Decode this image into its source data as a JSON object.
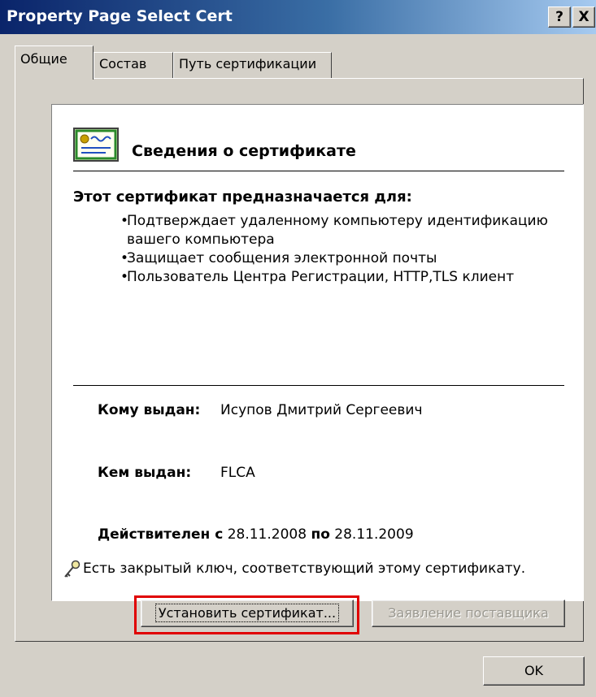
{
  "window": {
    "title": "Property Page Select Cert",
    "help_button": "?",
    "close_button": "X"
  },
  "tabs": [
    {
      "label": "Общие",
      "active": true
    },
    {
      "label": "Состав",
      "active": false
    },
    {
      "label": "Путь сертификации",
      "active": false
    }
  ],
  "certificate": {
    "icon": "certificate-icon",
    "title": "Сведения о сертификате",
    "purpose_heading": "Этот сертификат предназначается для:",
    "purposes": [
      "Подтверждает удаленному компьютеру идентификацию вашего компьютера",
      "Защищает сообщения электронной почты",
      "Пользователь Центра Регистрации, HTTP,TLS клиент"
    ],
    "issued_to_label": "Кому выдан:",
    "issued_to_value": "Исупов Дмитрий Сергеевич",
    "issued_by_label": "Кем выдан:",
    "issued_by_value": "FLCA",
    "valid_from_label": "Действителен с",
    "valid_from_value": "28.11.2008",
    "valid_to_label": "по",
    "valid_to_value": "28.11.2009",
    "private_key_icon": "key-icon",
    "private_key_text": "Есть закрытый ключ, соответствующий этому сертификату."
  },
  "buttons": {
    "install_certificate": "Установить сертификат...",
    "issuer_statement": "Заявление поставщика",
    "ok": "OK"
  },
  "colors": {
    "title_bar_start": "#0a246a",
    "title_bar_end": "#a6caf0",
    "highlight": "#e00000",
    "face": "#d4d0c8"
  }
}
